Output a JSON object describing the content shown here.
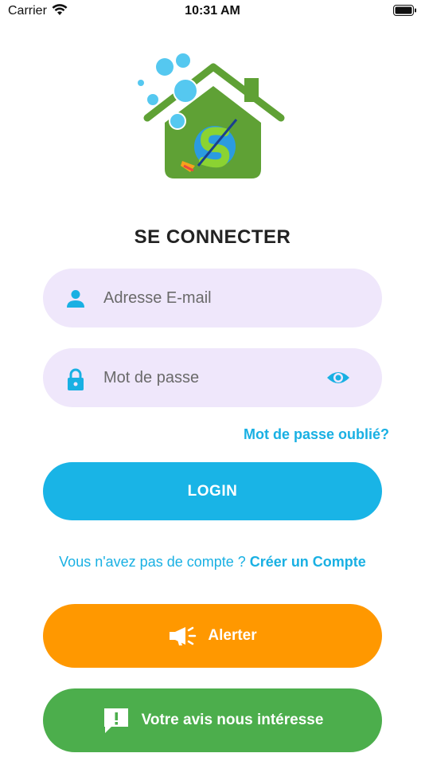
{
  "status_bar": {
    "carrier": "Carrier",
    "time": "10:31 AM"
  },
  "title": "SE CONNECTER",
  "email_field": {
    "placeholder": "Adresse E-mail",
    "icon": "person-icon"
  },
  "password_field": {
    "placeholder": "Mot de passe",
    "icon": "lock-icon",
    "toggle_icon": "eye-icon"
  },
  "forgot_password": "Mot de passe oublié?",
  "login_button": "LOGIN",
  "signup": {
    "prompt": "Vous n'avez pas de compte ?",
    "link": "Créer un Compte"
  },
  "alert_button": {
    "label": "Alerter",
    "icon": "megaphone-icon"
  },
  "feedback_button": {
    "label": "Votre avis nous intéresse",
    "icon": "feedback-icon"
  },
  "colors": {
    "accent": "#19b4e6",
    "alert": "#ff9800",
    "feedback": "#4cae4c",
    "field_bg": "#efe7fb",
    "logo_green": "#5fa135"
  }
}
